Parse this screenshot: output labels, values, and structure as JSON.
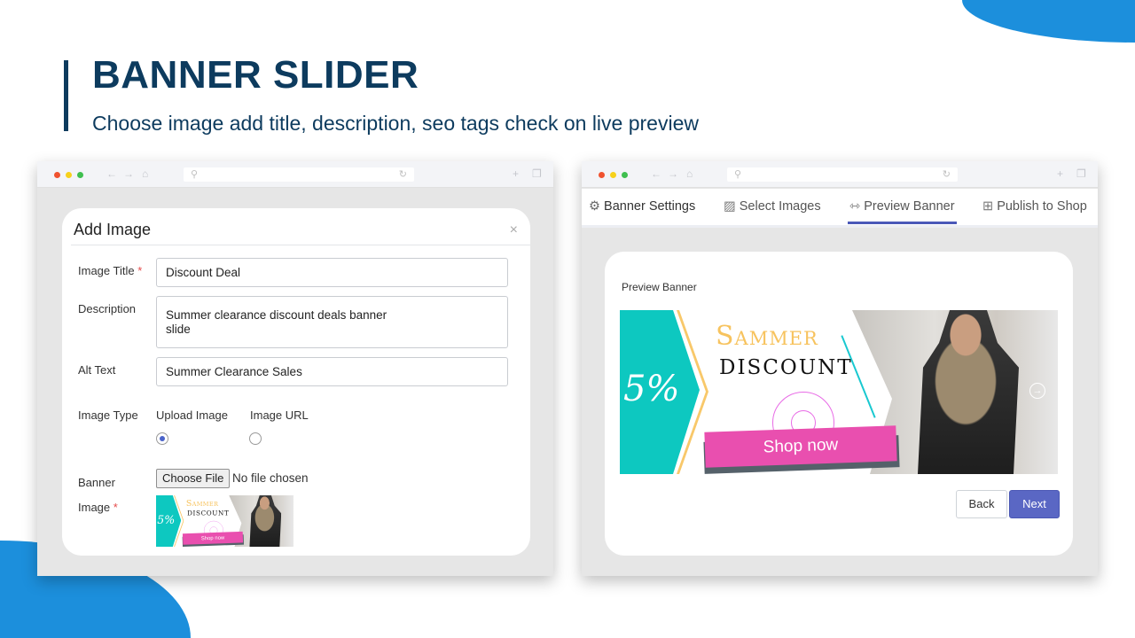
{
  "hero": {
    "title": "BANNER SLIDER",
    "subtitle": "Choose image add title, description, seo tags check on live preview"
  },
  "colors": {
    "brand": "#0d3b5e",
    "accent": "#1c8fdc",
    "primary_button": "#5a67c4"
  },
  "left_window": {
    "modal": {
      "title": "Add Image",
      "close": "×",
      "fields": {
        "image_title": {
          "label": "Image Title",
          "required": "*",
          "value": "Discount Deal"
        },
        "description": {
          "label": "Description",
          "value": "Summer clearance discount deals banner slide"
        },
        "alt_text": {
          "label": "Alt Text",
          "value": "Summer Clearance Sales"
        },
        "image_type": {
          "label": "Image Type",
          "options": [
            "Upload Image",
            "Image URL"
          ],
          "selected": "Upload Image"
        },
        "banner_image": {
          "label_line1": "Banner",
          "label_line2": "Image",
          "required": "*",
          "choose_file": "Choose File",
          "file_status": "No file chosen"
        }
      }
    }
  },
  "right_window": {
    "tabs": [
      "Banner Settings",
      "Select Images",
      "Preview Banner",
      "Publish to Shop"
    ],
    "active_tab": "Preview Banner",
    "preview_label": "Preview Banner",
    "back": "Back",
    "next": "Next"
  },
  "banner": {
    "percent": "5%",
    "headline": "Sammer",
    "subhead": "DISCOUNT",
    "cta": "Shop now"
  }
}
